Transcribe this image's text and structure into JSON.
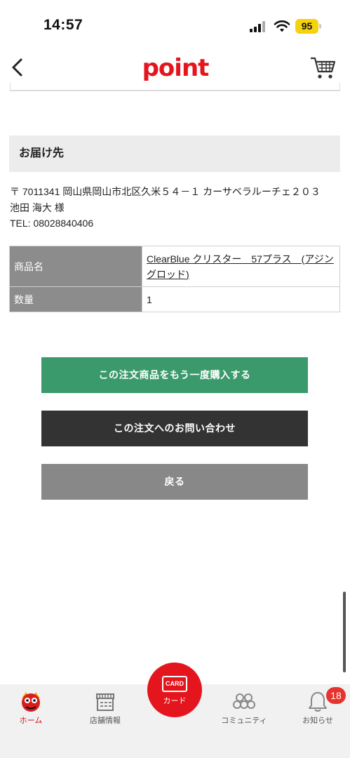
{
  "status_bar": {
    "time": "14:57",
    "battery": "95"
  },
  "header": {
    "logo_text": "point"
  },
  "delivery": {
    "heading": "お届け先",
    "address": "〒 7011341 岡山県岡山市北区久米５４－１ カーサベラルーチェ２０３",
    "name": "池田 海大 様",
    "tel": "TEL: 08028840406"
  },
  "table": {
    "product_label": "商品名",
    "product_value": "ClearBlue クリスター　57プラス　(アジングロッド)",
    "qty_label": "数量",
    "qty_value": "1"
  },
  "buttons": {
    "reorder": "この注文商品をもう一度購入する",
    "inquiry": "この注文へのお問い合わせ",
    "back": "戻る"
  },
  "tabbar": {
    "home": "ホーム",
    "stores": "店舗情報",
    "card_icon": "CARD",
    "card": "カード",
    "community": "コミュニティ",
    "notifications": "お知らせ",
    "badge_count": "18"
  },
  "colors": {
    "brand_red": "#e5151e",
    "reorder_green": "#3a9a6b",
    "inquiry_dark": "#333333",
    "back_gray": "#888888"
  }
}
